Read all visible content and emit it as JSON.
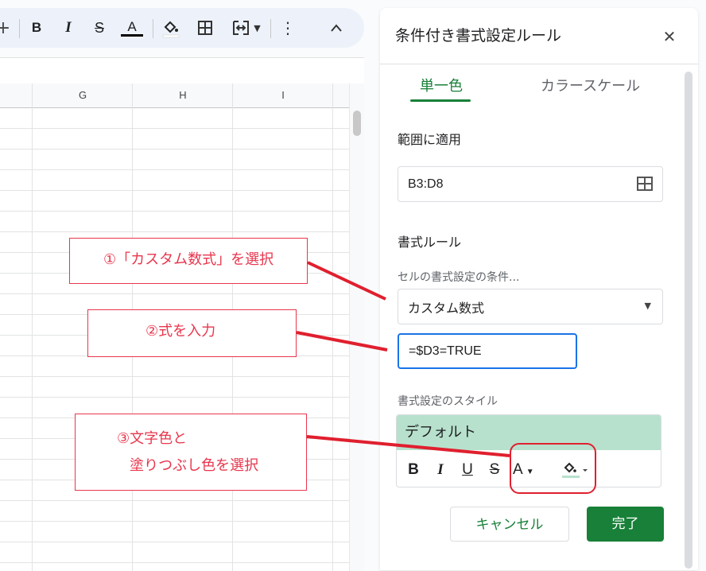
{
  "spreadsheet": {
    "columns": [
      "G",
      "H",
      "I"
    ]
  },
  "toolbar": {
    "icons": [
      "plus-icon",
      "bold-icon",
      "italic-icon",
      "strikethrough-icon",
      "text-color-icon",
      "fill-color-icon",
      "borders-icon",
      "merge-cells-icon",
      "more-icon",
      "collapse-icon"
    ],
    "bold": "B",
    "italic": "I",
    "strike": "S",
    "text_color": "A"
  },
  "panel": {
    "title": "条件付き書式設定ルール",
    "tabs": [
      "単一色",
      "カラースケール"
    ],
    "active_tab": "単一色",
    "range_label": "範囲に適用",
    "range_value": "B3:D8",
    "rules_label": "書式ルール",
    "condition_label": "セルの書式設定の条件...",
    "condition_value": "カスタム数式",
    "formula_value": "=$D3=TRUE",
    "style_label": "書式設定のスタイル",
    "style_preview": "デフォルト",
    "style_preview_bg": "#b7e1cd",
    "format_buttons": [
      "B",
      "I",
      "U",
      "S",
      "A"
    ],
    "cancel_label": "キャンセル",
    "done_label": "完了",
    "accent_color": "#188038"
  },
  "callouts": [
    {
      "text": "①「カスタム数式」を選択"
    },
    {
      "text": "②式を入力"
    },
    {
      "line1": "③文字色と",
      "line2": "塗りつぶし色を選択"
    }
  ],
  "annotation_color": "#e01f2e"
}
